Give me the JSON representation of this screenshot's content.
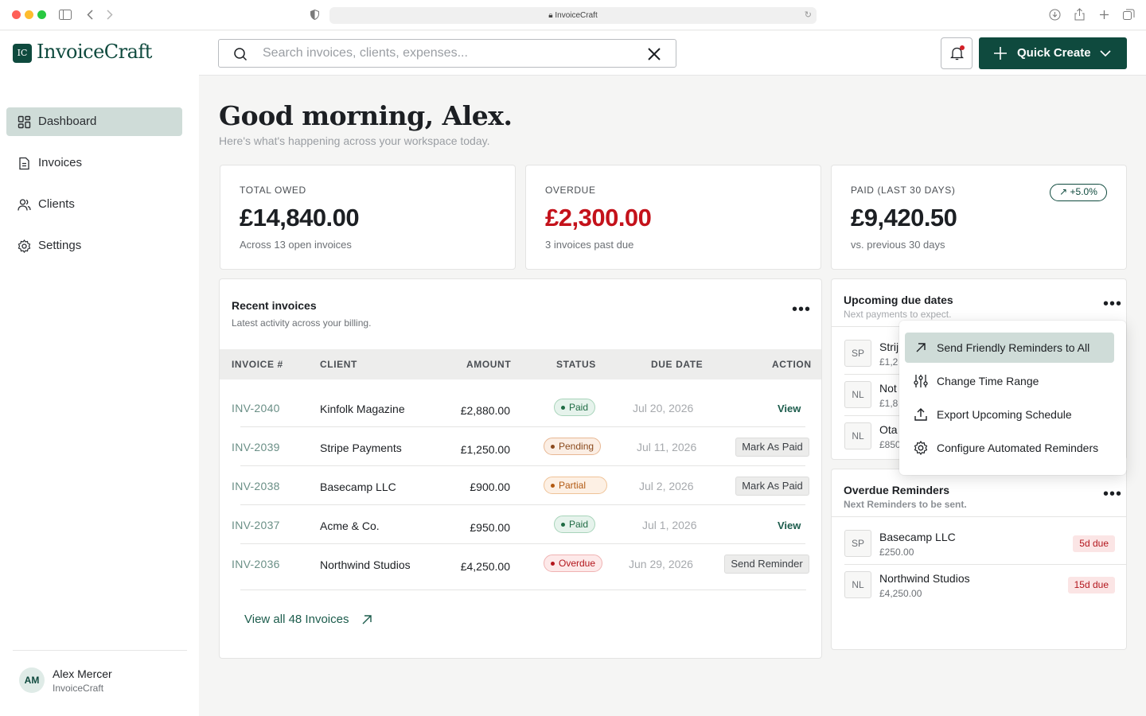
{
  "browser": {
    "url": "InvoiceCraft"
  },
  "brand": {
    "name": "InvoiceCraft",
    "accent": "#0f4a3e"
  },
  "sidebar": {
    "items": [
      {
        "label": "Dashboard",
        "icon": "dashboard-icon",
        "active": true
      },
      {
        "label": "Invoices",
        "icon": "document-icon",
        "active": false
      },
      {
        "label": "Clients",
        "icon": "users-icon",
        "active": false
      },
      {
        "label": "Settings",
        "icon": "gear-icon",
        "active": false
      }
    ],
    "user": {
      "initials": "AM",
      "name": "Alex Mercer",
      "org": "InvoiceCraft"
    }
  },
  "topbar": {
    "search_placeholder": "Search invoices, clients, expenses...",
    "quick_create_label": "Quick Create"
  },
  "greeting": {
    "title": "Good morning, Alex.",
    "subtitle": "Here's what's happening across your workspace today."
  },
  "stats": [
    {
      "label": "TOTAL OWED",
      "value": "£14,840.00",
      "note": "Across 13 open invoices"
    },
    {
      "label": "OVERDUE",
      "value": "£2,300.00",
      "note": "3 invoices past due",
      "color": "#c4121b"
    },
    {
      "label": "PAID (LAST 30 DAYS)",
      "value": "£9,420.50",
      "note": "vs. previous 30 days",
      "trend": "+5.0%"
    }
  ],
  "recent": {
    "title": "Recent invoices",
    "subtitle": "Latest activity across your billing.",
    "columns": [
      "INVOICE #",
      "CLIENT",
      "AMOUNT",
      "STATUS",
      "DUE DATE",
      "ACTION"
    ],
    "rows": [
      {
        "id": "INV-2040",
        "client": "Kinfolk Magazine",
        "amount": "£2,880.00",
        "status": "Paid",
        "due": "Jul 20, 2026",
        "action": "View"
      },
      {
        "id": "INV-2039",
        "client": "Stripe Payments",
        "amount": "£1,250.00",
        "status": "Pending",
        "due": "Jul 11, 2026",
        "action": "Mark As Paid"
      },
      {
        "id": "INV-2038",
        "client": "Basecamp LLC",
        "amount": "£900.00",
        "status": "Partial",
        "due": "Jul 2, 2026",
        "action": "Mark As Paid"
      },
      {
        "id": "INV-2037",
        "client": "Acme & Co.",
        "amount": "£950.00",
        "status": "Paid",
        "due": "Jul 1, 2026",
        "action": "View"
      },
      {
        "id": "INV-2036",
        "client": "Northwind Studios",
        "amount": "£4,250.00",
        "status": "Overdue",
        "due": "Jun 29, 2026",
        "action": "Send Reminder"
      }
    ],
    "view_all": "View all 48 Invoices"
  },
  "upcoming": {
    "title": "Upcoming due dates",
    "subtitle": "Next payments to expect.",
    "rows": [
      {
        "initials": "SP",
        "name": "Strij",
        "amount": "£1,2"
      },
      {
        "initials": "NL",
        "name": "Not",
        "amount": "£1,8"
      },
      {
        "initials": "NL",
        "name": "Ota",
        "amount": "£850"
      }
    ]
  },
  "menu": {
    "items": [
      {
        "label": "Send Friendly Reminders to All",
        "icon": "arrow-up-right-icon"
      },
      {
        "label": "Change Time Range",
        "icon": "sliders-icon"
      },
      {
        "label": "Export Upcoming Schedule",
        "icon": "upload-icon"
      },
      {
        "label": "Configure Automated Reminders",
        "icon": "gear-icon"
      }
    ]
  },
  "overdue": {
    "title": "Overdue Reminders",
    "subtitle": "Next Reminders to be sent.",
    "rows": [
      {
        "initials": "SP",
        "name": "Basecamp LLC",
        "amount": "£250.00",
        "badge": "5d due"
      },
      {
        "initials": "NL",
        "name": "Northwind Studios",
        "amount": "£4,250.00",
        "badge": "15d due"
      }
    ]
  }
}
